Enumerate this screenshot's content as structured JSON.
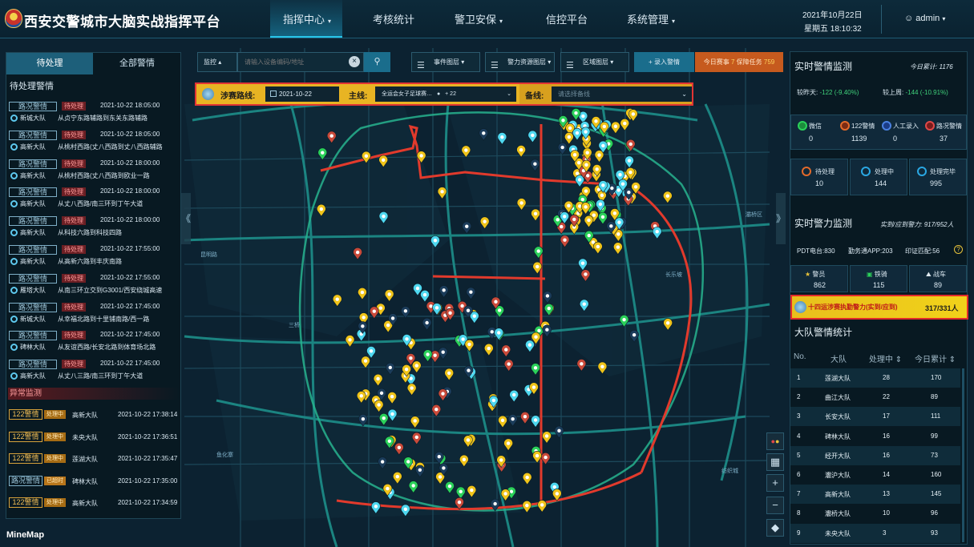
{
  "app": {
    "title": "西安交警城市大脑实战指挥平台"
  },
  "nav": [
    {
      "label": "指挥中心",
      "caret": "▾"
    },
    {
      "label": "考核统计",
      "caret": ""
    },
    {
      "label": "警卫安保",
      "caret": "▾"
    },
    {
      "label": "信控平台",
      "caret": ""
    },
    {
      "label": "系统管理",
      "caret": "▾"
    }
  ],
  "header": {
    "date": "2021年10月22日",
    "time": "星期五 18:10:32",
    "user": "admin"
  },
  "left": {
    "tabs": [
      "待处理",
      "全部警情"
    ],
    "pending_title": "待处理警情",
    "alarms": [
      {
        "type": "路况警情",
        "status": "待处理",
        "time": "2021-10-22 18:05:00",
        "unit": "新城大队",
        "addr": "从贞宁东路辅路到东关东路辅路"
      },
      {
        "type": "路况警情",
        "status": "待处理",
        "time": "2021-10-22 18:05:00",
        "unit": "高新大队",
        "addr": "从桃村西路(丈八西路到丈八西路辅路"
      },
      {
        "type": "路况警情",
        "status": "待处理",
        "time": "2021-10-22 18:00:00",
        "unit": "高新大队",
        "addr": "从桃村西路(丈八西路到欧业一路"
      },
      {
        "type": "路况警情",
        "status": "待处理",
        "time": "2021-10-22 18:00:00",
        "unit": "高新大队",
        "addr": "从丈八西路/南三环到丁午大道"
      },
      {
        "type": "路况警情",
        "status": "待处理",
        "time": "2021-10-22 18:00:00",
        "unit": "高新大队",
        "addr": "从科技六路到科技四路"
      },
      {
        "type": "路况警情",
        "status": "待处理",
        "time": "2021-10-22 17:55:00",
        "unit": "高新大队",
        "addr": "从高新六路到丰庆南路"
      },
      {
        "type": "路况警情",
        "status": "待处理",
        "time": "2021-10-22 17:55:00",
        "unit": "雁塔大队",
        "addr": "从南三环立交到G3001/西安绕城高速"
      },
      {
        "type": "路况警情",
        "status": "待处理",
        "time": "2021-10-22 17:45:00",
        "unit": "新城大队",
        "addr": "从幸福北路到十里铺南路/西一路"
      },
      {
        "type": "路况警情",
        "status": "待处理",
        "time": "2021-10-22 17:45:00",
        "unit": "碑林大队",
        "addr": "从友谊西路/长安北路到体育场北路"
      },
      {
        "type": "路况警情",
        "status": "待处理",
        "time": "2021-10-22 17:45:00",
        "unit": "高新大队",
        "addr": "从丈八三路/南三环到丁午大道"
      }
    ],
    "anomaly_title": "异常监测",
    "anomalies": [
      {
        "type": "122警情",
        "status": "处理中",
        "unit": "高新大队",
        "time": "2021-10-22 17:38:14"
      },
      {
        "type": "122警情",
        "status": "处理中",
        "unit": "未央大队",
        "time": "2021-10-22 17:36:51"
      },
      {
        "type": "122警情",
        "status": "处理中",
        "unit": "莲湖大队",
        "time": "2021-10-22 17:35:47"
      },
      {
        "type": "路况警情",
        "status": "已超时",
        "unit": "碑林大队",
        "time": "2021-10-22 17:35:00"
      },
      {
        "type": "122警情",
        "status": "处理中",
        "unit": "高新大队",
        "time": "2021-10-22 17:34:59"
      }
    ]
  },
  "toolbar": {
    "search_type": "监控",
    "search_placeholder": "请输入设备编码/地址",
    "event_layer": "事件图层",
    "police_layer": "警力资源图层",
    "area_layer": "区域图层",
    "record_btn": "+ 录入警情",
    "today_prefix": "今日赛事",
    "today_count": "7",
    "guarantee_label": "保障任务",
    "guarantee_count": "759"
  },
  "route": {
    "label": "涉赛路线:",
    "date": "2021-10-22",
    "main_label": "主线:",
    "main_value": "全运会女子足球赛…",
    "main_extra": "+ 22",
    "backup_label": "备线:",
    "backup_placeholder": "请选择备线"
  },
  "right": {
    "realtime_title": "实时警情监测",
    "today_total_label": "今日累计:",
    "today_total": "1176",
    "vs_yesterday_label": "较昨天:",
    "vs_yesterday": "-122 (-9.40%)",
    "vs_lastweek_label": "较上周:",
    "vs_lastweek": "-144 (-10.91%)",
    "sources": [
      {
        "label": "微信",
        "value": "0"
      },
      {
        "label": "122警情",
        "value": "1139"
      },
      {
        "label": "人工录入",
        "value": "0"
      },
      {
        "label": "路况警情",
        "value": "37"
      }
    ],
    "statuses": [
      {
        "label": "待处理",
        "value": "10"
      },
      {
        "label": "处理中",
        "value": "144"
      },
      {
        "label": "处理完毕",
        "value": "995"
      }
    ],
    "force_title": "实时警力监测",
    "force_ratio_label": "实到/应到警力:",
    "force_ratio": "917/952人",
    "pdt": "PDT电台:830",
    "app": "勤务通APP:203",
    "bind": "印证匹配:56",
    "units": [
      {
        "label": "警员",
        "value": "862"
      },
      {
        "label": "铁骑",
        "value": "115"
      },
      {
        "label": "战车",
        "value": "89"
      }
    ],
    "highlight_label": "十四运涉赛执勤警力(实到/应到)",
    "highlight_value": "317/331人",
    "brigade_title": "大队警情统计",
    "table_headers": [
      "No.",
      "大队",
      "处理中 ⇕",
      "今日累计 ⇕"
    ],
    "brigades": [
      {
        "no": "1",
        "name": "莲湖大队",
        "processing": "28",
        "total": "170"
      },
      {
        "no": "2",
        "name": "曲江大队",
        "processing": "22",
        "total": "89"
      },
      {
        "no": "3",
        "name": "长安大队",
        "processing": "17",
        "total": "111"
      },
      {
        "no": "4",
        "name": "碑林大队",
        "processing": "16",
        "total": "99"
      },
      {
        "no": "5",
        "name": "经开大队",
        "processing": "16",
        "total": "73"
      },
      {
        "no": "6",
        "name": "灞沪大队",
        "processing": "14",
        "total": "160"
      },
      {
        "no": "7",
        "name": "高新大队",
        "processing": "13",
        "total": "145"
      },
      {
        "no": "8",
        "name": "灞桥大队",
        "processing": "10",
        "total": "96"
      },
      {
        "no": "9",
        "name": "未央大队",
        "processing": "3",
        "total": "93"
      }
    ]
  },
  "map": {
    "brand": "MineMap",
    "attribution": ""
  },
  "colors": {
    "accent": "#28c4e8",
    "route": "#e23a2c",
    "alert": "#e13434"
  }
}
